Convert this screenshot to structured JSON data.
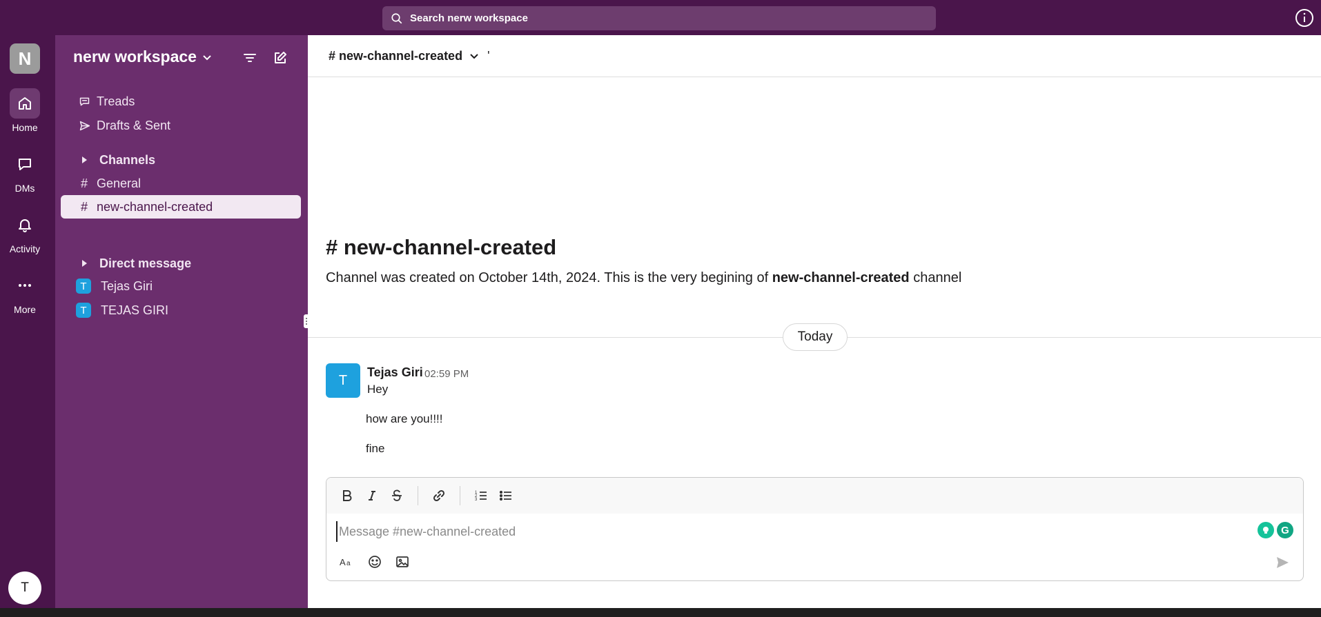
{
  "search": {
    "placeholder": "Search nerw workspace"
  },
  "rail": {
    "workspace_initial": "N",
    "items": [
      {
        "label": "Home",
        "icon": "home-icon",
        "active": true
      },
      {
        "label": "DMs",
        "icon": "chat-bubble-icon",
        "active": false
      },
      {
        "label": "Activity",
        "icon": "bell-icon",
        "active": false
      },
      {
        "label": "More",
        "icon": "ellipsis-icon",
        "active": false
      }
    ],
    "user_initial": "T"
  },
  "sidebar": {
    "workspace_name": "nerw workspace",
    "threads_label": "Treads",
    "drafts_label": "Drafts & Sent",
    "channels_section": "Channels",
    "channels": [
      {
        "label": "General",
        "active": false
      },
      {
        "label": "new-channel-created",
        "active": true
      }
    ],
    "dm_section": "Direct message",
    "dms": [
      {
        "initial": "T",
        "label": "Tejas Giri"
      },
      {
        "initial": "T",
        "label": "TEJAS GIRI"
      }
    ]
  },
  "header": {
    "channel_title": "# new-channel-created",
    "tick": "'"
  },
  "intro": {
    "title": "# new-channel-created",
    "text_before": "Channel was created on October 14th, 2024. This is the very begining of ",
    "channel_name": "new-channel-created",
    "text_after": " channel"
  },
  "divider": {
    "label": "Today"
  },
  "message": {
    "avatar_initial": "T",
    "author": "Tejas Giri",
    "time": "02:59 PM",
    "lines": [
      "Hey",
      "how are you!!!!",
      "fine"
    ]
  },
  "composer": {
    "placeholder": "Message #new-channel-created",
    "value": "",
    "format_buttons": [
      "bold-icon",
      "italic-icon",
      "strikethrough-icon",
      "link-icon",
      "ordered-list-icon",
      "bullet-list-icon"
    ],
    "grammarly_letter": "G"
  },
  "colors": {
    "top_bar": "#4a154b",
    "sidebar": "#6b2e6d",
    "active_channel_bg": "#f2e8f2",
    "avatar_blue": "#1ea1de"
  }
}
